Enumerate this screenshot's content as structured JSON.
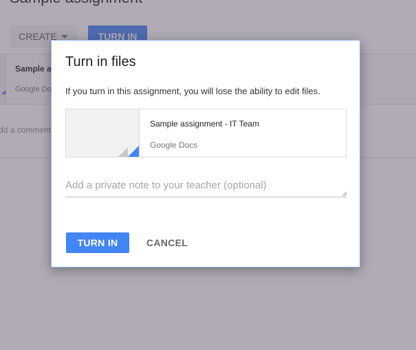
{
  "background": {
    "page_title": "Sample assignment",
    "create_label": "CREATE",
    "turn_in_label": "TURN IN",
    "attachment_title": "Sample assignment - IT Team",
    "attachment_type": "Google Docs",
    "comment_placeholder": "Add a comment..."
  },
  "dialog": {
    "title": "Turn in files",
    "message": "If you turn in this assignment, you will lose the ability to edit files.",
    "file": {
      "name": "Sample assignment - IT Team",
      "type": "Google Docs"
    },
    "note": {
      "placeholder": "Add a private note to your teacher (optional)",
      "value": ""
    },
    "turn_in_label": "TURN IN",
    "cancel_label": "CANCEL"
  },
  "colors": {
    "accent": "#4285f4",
    "overlay": "#5c5064"
  }
}
